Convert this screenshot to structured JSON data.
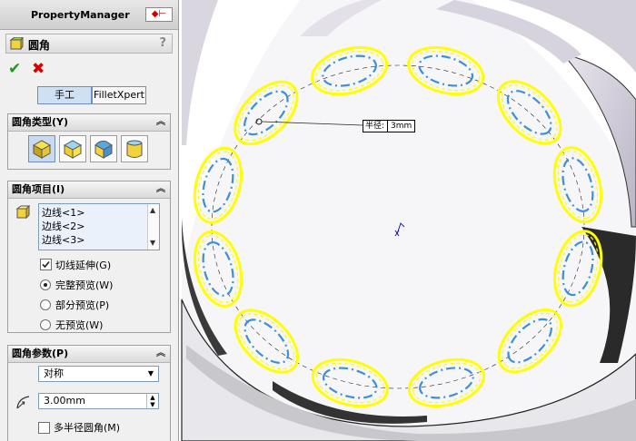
{
  "property_manager": {
    "title": "PropertyManager",
    "feature_title": "圆角",
    "help_glyph": "?",
    "ok_glyph": "✔",
    "cancel_glyph": "✖",
    "tabs": {
      "manual": "手工",
      "filletxpert": "FilletXpert"
    }
  },
  "fillet_type": {
    "heading": "圆角类型(Y)",
    "buttons": [
      {
        "icon": "constant-radius-fillet-icon",
        "selected": true
      },
      {
        "icon": "variable-radius-fillet-icon",
        "selected": false
      },
      {
        "icon": "face-fillet-icon",
        "selected": false
      },
      {
        "icon": "full-round-fillet-icon",
        "selected": false
      }
    ]
  },
  "fillet_items": {
    "heading": "圆角项目(I)",
    "edges": [
      "边线<1>",
      "边线<2>",
      "边线<3>"
    ],
    "tangent_propagation": {
      "label": "切线延伸(G)",
      "checked": true
    },
    "preview_options": [
      {
        "label": "完整预览(W)",
        "selected": true
      },
      {
        "label": "部分预览(P)",
        "selected": false
      },
      {
        "label": "无预览(W)",
        "selected": false
      }
    ]
  },
  "fillet_params": {
    "heading": "圆角参数(P)",
    "mode": "对称",
    "radius": "3.00mm",
    "multi_radius": {
      "label": "多半径圆角(M)",
      "checked": false
    }
  },
  "viewport": {
    "radius_label": "半径:",
    "radius_value": "3mm"
  },
  "colors": {
    "highlight_yellow": "#ffff00",
    "edge_blue": "#3d8fd6",
    "selected_blue": "#c9d9ee",
    "ok_green": "#1a9b1a",
    "cancel_red": "#d40000"
  }
}
